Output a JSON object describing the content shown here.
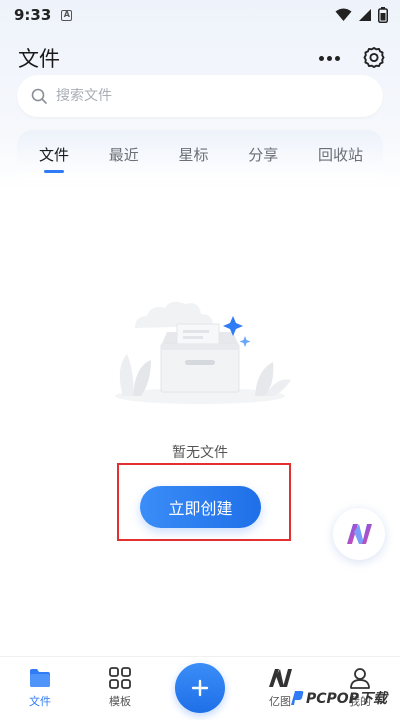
{
  "status_bar": {
    "time": "9:33",
    "notification_letter": "A"
  },
  "header": {
    "title": "文件"
  },
  "search": {
    "placeholder": "搜索文件",
    "value": ""
  },
  "tabs": [
    {
      "label": "文件",
      "active": true
    },
    {
      "label": "最近",
      "active": false
    },
    {
      "label": "星标",
      "active": false
    },
    {
      "label": "分享",
      "active": false
    },
    {
      "label": "回收站",
      "active": false
    }
  ],
  "empty_state": {
    "message": "暂无文件",
    "create_label": "立即创建"
  },
  "bottom_nav": {
    "items": [
      {
        "label": "文件",
        "icon": "folder-icon",
        "active": true
      },
      {
        "label": "模板",
        "icon": "grid-icon",
        "active": false
      },
      {
        "label": "亿图",
        "icon": "edraw-logo-icon",
        "active": false
      },
      {
        "label": "我的",
        "icon": "user-icon",
        "active": false
      }
    ]
  },
  "watermark": {
    "text": "PCPOP下载"
  },
  "colors": {
    "accent": "#2f7cf6",
    "highlight": "#e23030",
    "header_bg": "#eef3fb"
  }
}
